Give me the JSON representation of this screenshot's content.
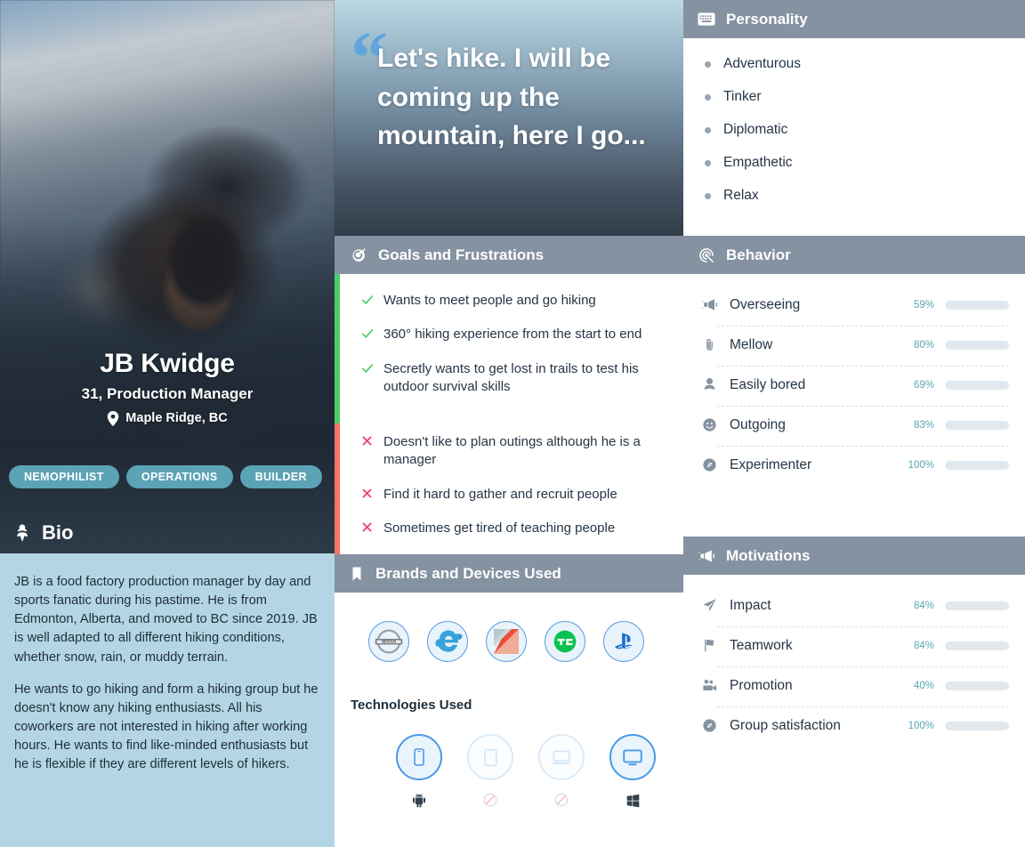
{
  "profile": {
    "name": "JB Kwidge",
    "role": "31, Production Manager",
    "location": "Maple Ridge, BC",
    "location_icon": "map-pin-icon",
    "tags": [
      "NEMOPHILIST",
      "OPERATIONS",
      "BUILDER"
    ],
    "photo_alt": "man drinking water in front of mountain"
  },
  "bio": {
    "header": "Bio",
    "header_icon": "user-badge-icon",
    "paragraphs": [
      "JB is a food factory production manager by day and sports fanatic during his pastime. He is from Edmonton, Alberta, and moved to BC since 2019. JB is well adapted to all different hiking conditions, whether snow, rain, or muddy terrain.",
      "He wants to go hiking and form a hiking group but he doesn't know any hiking enthusiasts. All his coworkers are not interested in hiking after working hours. He wants to find like-minded enthusiasts but he is flexible if they are different levels of hikers."
    ]
  },
  "quote": {
    "mark": "“",
    "text": "Let's hike. I will be coming up the mountain, here I go..."
  },
  "personality": {
    "header": "Personality",
    "header_icon": "keyboard-icon",
    "items": [
      "Adventurous",
      "Tinker",
      "Diplomatic",
      "Empathetic",
      "Relax"
    ]
  },
  "goals": {
    "header": "Goals and Frustrations",
    "header_icon": "target-icon",
    "goal_rail_color": "#4ecd6b",
    "frustration_rail_color": "#fa7268",
    "goals": [
      "Wants to meet people and go hiking",
      "360° hiking experience from the start to end",
      "Secretly wants to get lost in trails to test his outdoor survival skills"
    ],
    "frustrations": [
      "Doesn't like to plan outings although he is a manager",
      "Find it hard to gather and recruit people",
      "Sometimes get tired of teaching people"
    ]
  },
  "behavior": {
    "header": "Behavior",
    "header_icon": "fingerprint-icon",
    "accent": "#4f9bb0",
    "items": [
      {
        "label": "Overseeing",
        "percent": 59,
        "percent_label": "59%",
        "icon": "megaphone-icon"
      },
      {
        "label": "Mellow",
        "percent": 80,
        "percent_label": "80%",
        "icon": "paperclip-icon"
      },
      {
        "label": "Easily bored",
        "percent": 69,
        "percent_label": "69%",
        "icon": "user-tie-icon"
      },
      {
        "label": "Outgoing",
        "percent": 83,
        "percent_label": "83%",
        "icon": "smiley-icon"
      },
      {
        "label": "Experimenter",
        "percent": 100,
        "percent_label": "100%",
        "icon": "compass-icon"
      }
    ]
  },
  "motivations": {
    "header": "Motivations",
    "header_icon": "megaphone-icon",
    "accent": "#4f9bb0",
    "items": [
      {
        "label": "Impact",
        "percent": 84,
        "percent_label": "84%",
        "icon": "paper-plane-icon"
      },
      {
        "label": "Teamwork",
        "percent": 84,
        "percent_label": "84%",
        "icon": "flag-icon"
      },
      {
        "label": "Promotion",
        "percent": 40,
        "percent_label": "40%",
        "icon": "video-camera-icon"
      },
      {
        "label": "Group satisfaction",
        "percent": 100,
        "percent_label": "100%",
        "icon": "compass-icon"
      }
    ]
  },
  "brands": {
    "header": "Brands and Devices Used",
    "header_icon": "bookmark-icon",
    "items": [
      {
        "name": "Nissan",
        "icon": "nissan-logo-icon"
      },
      {
        "name": "Internet Explorer",
        "icon": "internet-explorer-logo-icon"
      },
      {
        "name": "Kotlin",
        "icon": "kotlin-logo-icon"
      },
      {
        "name": "TechCrunch",
        "icon": "techcrunch-logo-icon"
      },
      {
        "name": "PlayStation",
        "icon": "playstation-logo-icon"
      }
    ],
    "tech_title": "Technologies Used",
    "devices": [
      {
        "name": "Phone",
        "icon": "mobile-phone-icon",
        "active": true,
        "os": "android-icon",
        "os_name": "Android"
      },
      {
        "name": "Tablet",
        "icon": "tablet-icon",
        "active": false,
        "os": "none-icon",
        "os_name": "None"
      },
      {
        "name": "Laptop",
        "icon": "laptop-icon",
        "active": false,
        "os": "none-icon",
        "os_name": "None"
      },
      {
        "name": "Desktop",
        "icon": "desktop-icon",
        "active": true,
        "os": "windows-icon",
        "os_name": "Windows"
      }
    ]
  }
}
